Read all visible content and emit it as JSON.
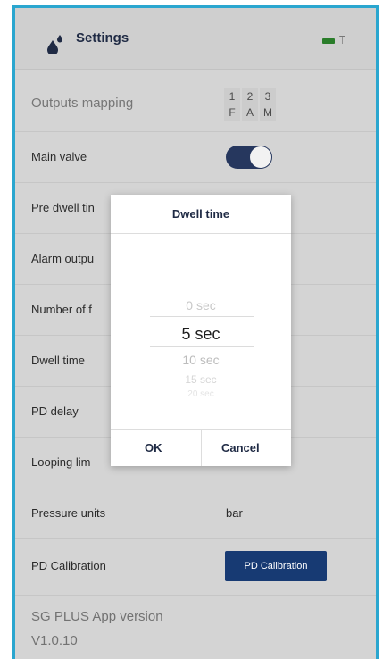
{
  "header": {
    "title": "Settings"
  },
  "rows": {
    "outputs_mapping": {
      "label": "Outputs mapping",
      "cols": [
        {
          "n": "1",
          "l": "F"
        },
        {
          "n": "2",
          "l": "A"
        },
        {
          "n": "3",
          "l": "M"
        }
      ]
    },
    "main_valve": {
      "label": "Main valve",
      "toggle_on": true
    },
    "pre_dwell": {
      "label": "Pre dwell tin"
    },
    "alarm_output": {
      "label": "Alarm outpu"
    },
    "number_of": {
      "label": "Number of f"
    },
    "dwell_time": {
      "label": "Dwell time"
    },
    "pd_delay": {
      "label": "PD delay"
    },
    "looping": {
      "label": "Looping lim"
    },
    "pressure_units": {
      "label": "Pressure units",
      "value": "bar"
    },
    "pd_calibration": {
      "label": "PD Calibration",
      "button": "PD Calibration"
    }
  },
  "version": {
    "line1": "SG PLUS App version",
    "line2": "V1.0.10"
  },
  "dialog": {
    "title": "Dwell time",
    "options": [
      "0 sec",
      "5 sec",
      "10 sec",
      "15 sec",
      "20 sec"
    ],
    "selected": "5 sec",
    "ok": "OK",
    "cancel": "Cancel"
  },
  "colors": {
    "accent": "#26375e",
    "button": "#173a73",
    "frame": "#2aa6cf"
  }
}
